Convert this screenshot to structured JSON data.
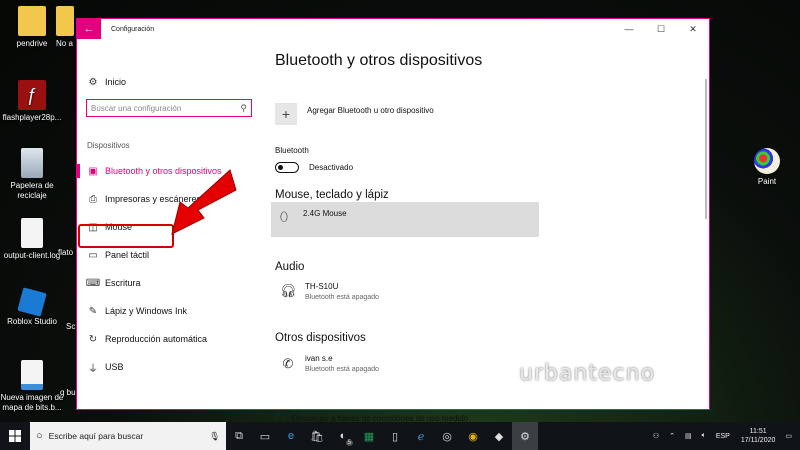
{
  "desktop": {
    "icons": [
      {
        "label": "pendrive",
        "icon": "usb-drive-icon"
      },
      {
        "label": "No a",
        "icon": "folder-icon"
      },
      {
        "label": "flashplayer28p...",
        "icon": "flash-icon"
      },
      {
        "label": "Papelera de reciclaje",
        "icon": "recycle-bin-icon"
      },
      {
        "label": "output-client.log",
        "icon": "file-icon"
      },
      {
        "label": "flato",
        "icon": "file-icon"
      },
      {
        "label": "Roblox Studio",
        "icon": "roblox-icon"
      },
      {
        "label": "Sc",
        "icon": "file-icon"
      },
      {
        "label": "Nueva imagen de mapa de bits.b...",
        "icon": "image-icon"
      },
      {
        "label": "q bu",
        "icon": "file-icon"
      },
      {
        "label": "Paint",
        "icon": "paint-icon"
      }
    ]
  },
  "window": {
    "title": "Configuración",
    "back_icon": "arrow-left-icon",
    "controls": {
      "minimize": "—",
      "maximize": "☐",
      "close": "✕"
    }
  },
  "sidebar": {
    "home_label": "Inicio",
    "search_placeholder": "Buscar una configuración",
    "section_label": "Dispositivos",
    "items": [
      {
        "label": "Bluetooth y otros dispositivos",
        "icon": "bluetooth-device-icon",
        "active": true
      },
      {
        "label": "Impresoras y escáneres",
        "icon": "printer-icon"
      },
      {
        "label": "Mouse",
        "icon": "mouse-icon"
      },
      {
        "label": "Panel táctil",
        "icon": "touchpad-icon"
      },
      {
        "label": "Escritura",
        "icon": "keyboard-icon"
      },
      {
        "label": "Lápiz y Windows Ink",
        "icon": "pen-icon"
      },
      {
        "label": "Reproducción automática",
        "icon": "autoplay-icon"
      },
      {
        "label": "USB",
        "icon": "usb-icon"
      }
    ]
  },
  "content": {
    "title": "Bluetooth y otros dispositivos",
    "add_label": "Agregar Bluetooth u otro dispositivo",
    "bluetooth_label": "Bluetooth",
    "bluetooth_state": "Desactivado",
    "mouse_section": "Mouse, teclado y lápiz",
    "mouse_device": "2.4G Mouse",
    "audio_section": "Audio",
    "audio_device": "TH-S10U",
    "audio_status": "Bluetooth está apagado",
    "other_section": "Otros dispositivos",
    "other_device": "ivan s.e",
    "other_status": "Bluetooth está apagado",
    "metered_label": "Descargar a través de conexiones de uso medido"
  },
  "watermark": "urbantecno",
  "taskbar": {
    "search_placeholder": "Escribe aquí para buscar",
    "badge_count": "5",
    "language": "ESP",
    "time": "11:51",
    "date": "17/11/2020"
  },
  "colors": {
    "accent": "#e3007e",
    "highlight": "#d40000"
  }
}
